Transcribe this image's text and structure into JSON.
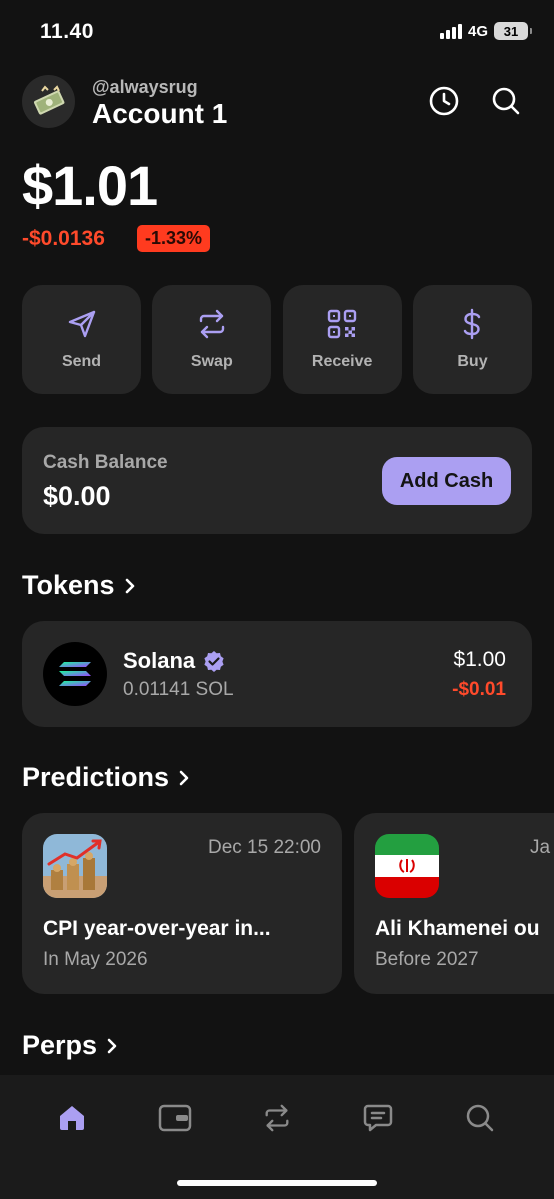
{
  "status_bar": {
    "time": "11.40",
    "network": "4G",
    "battery": "31"
  },
  "account": {
    "handle": "@alwaysrug",
    "name": "Account 1"
  },
  "portfolio": {
    "balance": "$1.01",
    "change_abs": "-$0.0136",
    "change_pct": "-1.33%"
  },
  "actions": [
    {
      "label": "Send",
      "icon": "send-icon"
    },
    {
      "label": "Swap",
      "icon": "swap-icon"
    },
    {
      "label": "Receive",
      "icon": "qr-code-icon"
    },
    {
      "label": "Buy",
      "icon": "dollar-icon"
    }
  ],
  "cash": {
    "title": "Cash Balance",
    "value": "$0.00",
    "button": "Add Cash"
  },
  "tokens": {
    "title": "Tokens",
    "items": [
      {
        "name": "Solana",
        "amount": "0.01141 SOL",
        "value": "$1.00",
        "change": "-$0.01"
      }
    ]
  },
  "predictions": {
    "title": "Predictions",
    "items": [
      {
        "date": "Dec 15 22:00",
        "title": "CPI year-over-year in...",
        "subtitle": "In May 2026"
      },
      {
        "date": "Ja",
        "title": "Ali Khamenei ou",
        "subtitle": "Before 2027"
      }
    ]
  },
  "perps": {
    "title": "Perps"
  },
  "nav": [
    "home-icon",
    "wallet-icon",
    "swap-icon",
    "chat-icon",
    "search-icon"
  ],
  "colors": {
    "accent": "#ab9ff2",
    "negative": "#ff4a2b",
    "card": "#262626",
    "background": "#121212"
  }
}
